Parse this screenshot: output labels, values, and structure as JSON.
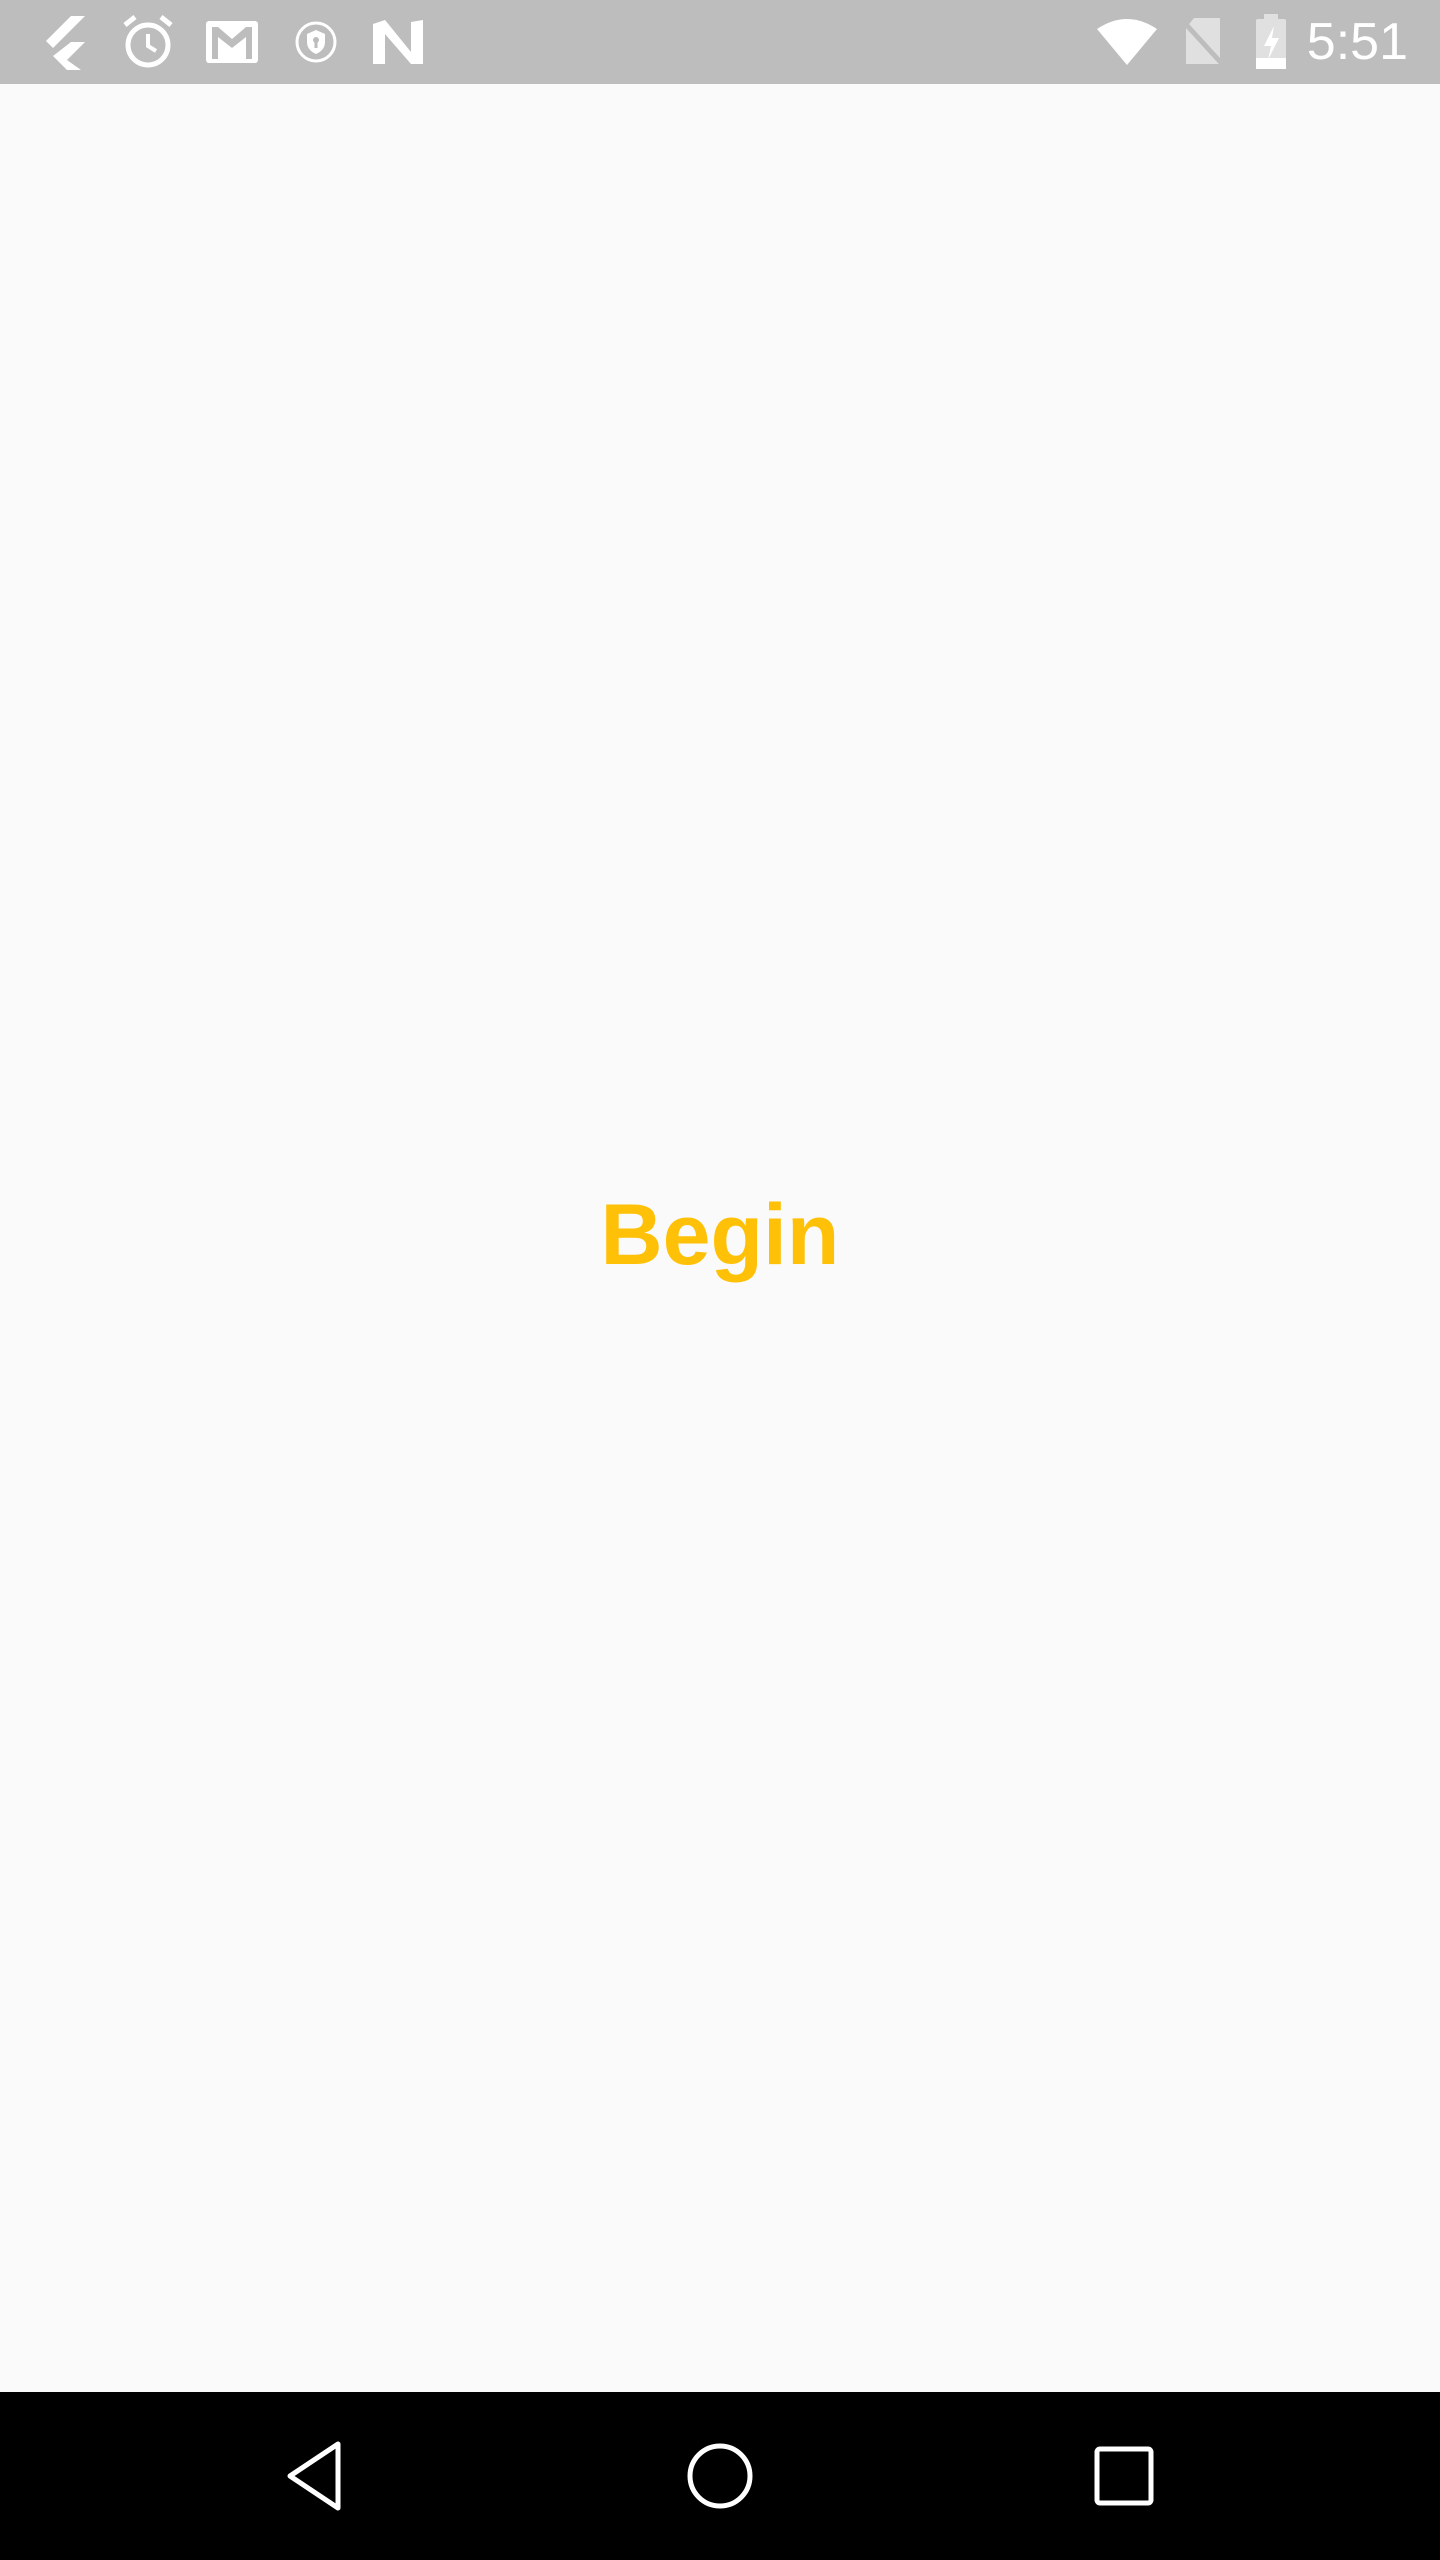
{
  "status_bar": {
    "time": "5:51",
    "left_icons": [
      "flutter-icon",
      "alarm-icon",
      "gmail-icon",
      "vpn-shield-icon",
      "n-app-icon"
    ],
    "right_icons": [
      "wifi-icon",
      "no-sim-icon",
      "battery-charging-icon"
    ]
  },
  "main": {
    "begin_label": "Begin"
  },
  "nav_bar": {
    "buttons": [
      "back-icon",
      "home-icon",
      "recents-icon"
    ]
  },
  "colors": {
    "status_bar": "#bdbdbd",
    "background": "#fafafa",
    "accent": "#ffc107",
    "nav_bar": "#000000"
  }
}
